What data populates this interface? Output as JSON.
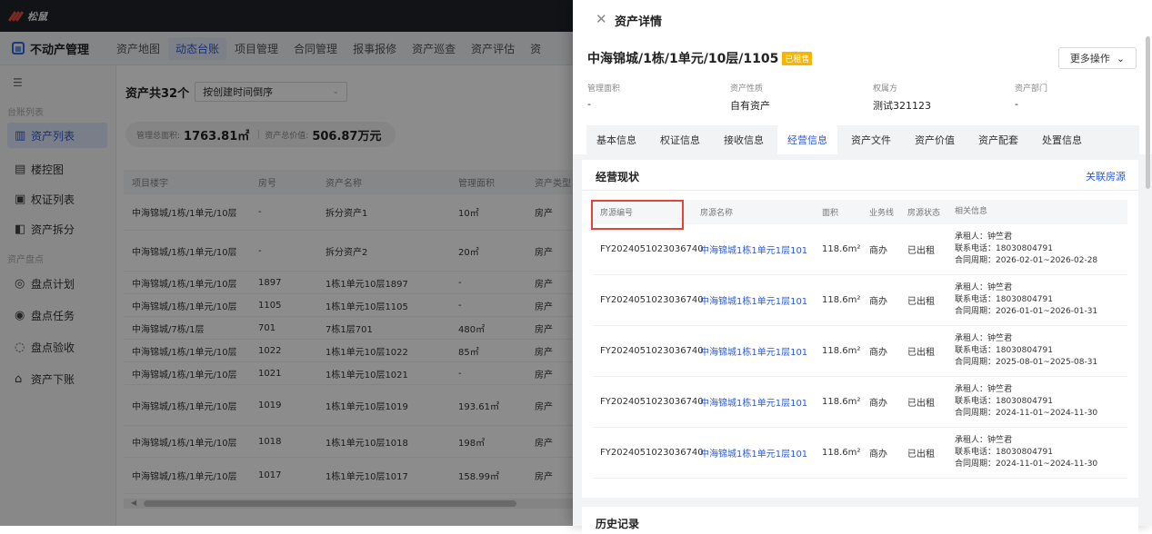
{
  "topbar": {
    "brand": "松鼠"
  },
  "navbar": {
    "app_title": "不动产管理",
    "app_icon": "app-logo-icon",
    "items": [
      {
        "label": "资产地图"
      },
      {
        "label": "动态台账",
        "active": true
      },
      {
        "label": "项目管理"
      },
      {
        "label": "合同管理"
      },
      {
        "label": "报事报修"
      },
      {
        "label": "资产巡查"
      },
      {
        "label": "资产评估"
      },
      {
        "label": "资"
      }
    ]
  },
  "sidebar": {
    "group1": "台账列表",
    "group2": "资产盘点",
    "items": [
      {
        "label": "资产列表",
        "icon": "building-icon",
        "active": true
      },
      {
        "label": "楼控图",
        "icon": "grid-icon"
      },
      {
        "label": "权证列表",
        "icon": "certificate-icon"
      },
      {
        "label": "资产拆分",
        "icon": "split-icon"
      },
      {
        "label": "盘点计划",
        "icon": "plan-icon"
      },
      {
        "label": "盘点任务",
        "icon": "task-icon"
      },
      {
        "label": "盘点验收",
        "icon": "check-icon"
      },
      {
        "label": "资产下账",
        "icon": "write-off-icon"
      }
    ]
  },
  "main": {
    "count": "资产共32个",
    "sort": "按创建时间倒序",
    "stats": {
      "area_label": "管理总面积:",
      "area_value": "1763.81㎡",
      "value_label": "资产总价值:",
      "value_value": "506.87万元"
    },
    "columns": [
      "项目楼宇",
      "房号",
      "资产名称",
      "管理面积",
      "资产类型"
    ],
    "rows": [
      [
        "中海锦城/1栋/1单元/10层",
        "-",
        "拆分资产1",
        "10㎡",
        "房产"
      ],
      [
        "中海锦城/1栋/1单元/10层",
        "-",
        "拆分资产2",
        "20㎡",
        "房产"
      ],
      [
        "中海锦城/1栋/1单元/10层",
        "1897",
        "1栋1单元10层1897",
        "-",
        "房产"
      ],
      [
        "中海锦城/1栋/1单元/10层",
        "1105",
        "1栋1单元10层1105",
        "-",
        "房产"
      ],
      [
        "中海锦城/7栋/1层",
        "701",
        "7栋1层701",
        "480㎡",
        "房产"
      ],
      [
        "中海锦城/1栋/1单元/10层",
        "1022",
        "1栋1单元10层1022",
        "85㎡",
        "房产"
      ],
      [
        "中海锦城/1栋/1单元/10层",
        "1021",
        "1栋1单元10层1021",
        "-",
        "房产"
      ],
      [
        "中海锦城/1栋/1单元/10层",
        "1019",
        "1栋1单元10层1019",
        "193.61㎡",
        "房产"
      ],
      [
        "中海锦城/1栋/1单元/10层",
        "1018",
        "1栋1单元10层1018",
        "198㎡",
        "房产"
      ],
      [
        "中海锦城/1栋/1单元/10层",
        "1017",
        "1栋1单元10层1017",
        "158.99㎡",
        "房产"
      ]
    ]
  },
  "drawer": {
    "title": "资产详情",
    "asset_name": "中海锦城/1栋/1单元/10层/1105",
    "badge": "已租售",
    "more_btn": "更多操作",
    "meta": [
      {
        "label": "管理面积",
        "value": "-"
      },
      {
        "label": "资产性质",
        "value": "自有资产"
      },
      {
        "label": "权属方",
        "value": "测试321123"
      },
      {
        "label": "资产部门",
        "value": "-"
      }
    ],
    "tabs": [
      "基本信息",
      "权证信息",
      "接收信息",
      "经营信息",
      "资产文件",
      "资产价值",
      "资产配套",
      "处置信息"
    ],
    "active_tab": "经营信息",
    "section_title": "经营现状",
    "section_link": "关联房源",
    "columns": [
      "房源编号",
      "房源名称",
      "面积",
      "业务线",
      "房源状态",
      "相关信息"
    ],
    "rows": [
      {
        "code": "FY2024051023036740",
        "name": "中海锦城1栋1单元1层101",
        "area": "118.6m²",
        "line": "商办",
        "status": "已出租",
        "tenant": "承租人：钟竺君",
        "phone": "联系电话：18030804791",
        "period": "合同周期：2026-02-01~2026-02-28"
      },
      {
        "code": "FY2024051023036740",
        "name": "中海锦城1栋1单元1层101",
        "area": "118.6m²",
        "line": "商办",
        "status": "已出租",
        "tenant": "承租人：钟竺君",
        "phone": "联系电话：18030804791",
        "period": "合同周期：2026-01-01~2026-01-31"
      },
      {
        "code": "FY2024051023036740",
        "name": "中海锦城1栋1单元1层101",
        "area": "118.6m²",
        "line": "商办",
        "status": "已出租",
        "tenant": "承租人：钟竺君",
        "phone": "联系电话：18030804791",
        "period": "合同周期：2025-08-01~2025-08-31"
      },
      {
        "code": "FY2024051023036740",
        "name": "中海锦城1栋1单元1层101",
        "area": "118.6m²",
        "line": "商办",
        "status": "已出租",
        "tenant": "承租人：钟竺君",
        "phone": "联系电话：18030804791",
        "period": "合同周期：2024-11-01~2024-11-30"
      },
      {
        "code": "FY2024051023036740",
        "name": "中海锦城1栋1单元1层101",
        "area": "118.6m²",
        "line": "商办",
        "status": "已出租",
        "tenant": "承租人：钟竺君",
        "phone": "联系电话：18030804791",
        "period": "合同周期：2024-11-01~2024-11-30"
      }
    ],
    "history_title": "历史记录"
  }
}
